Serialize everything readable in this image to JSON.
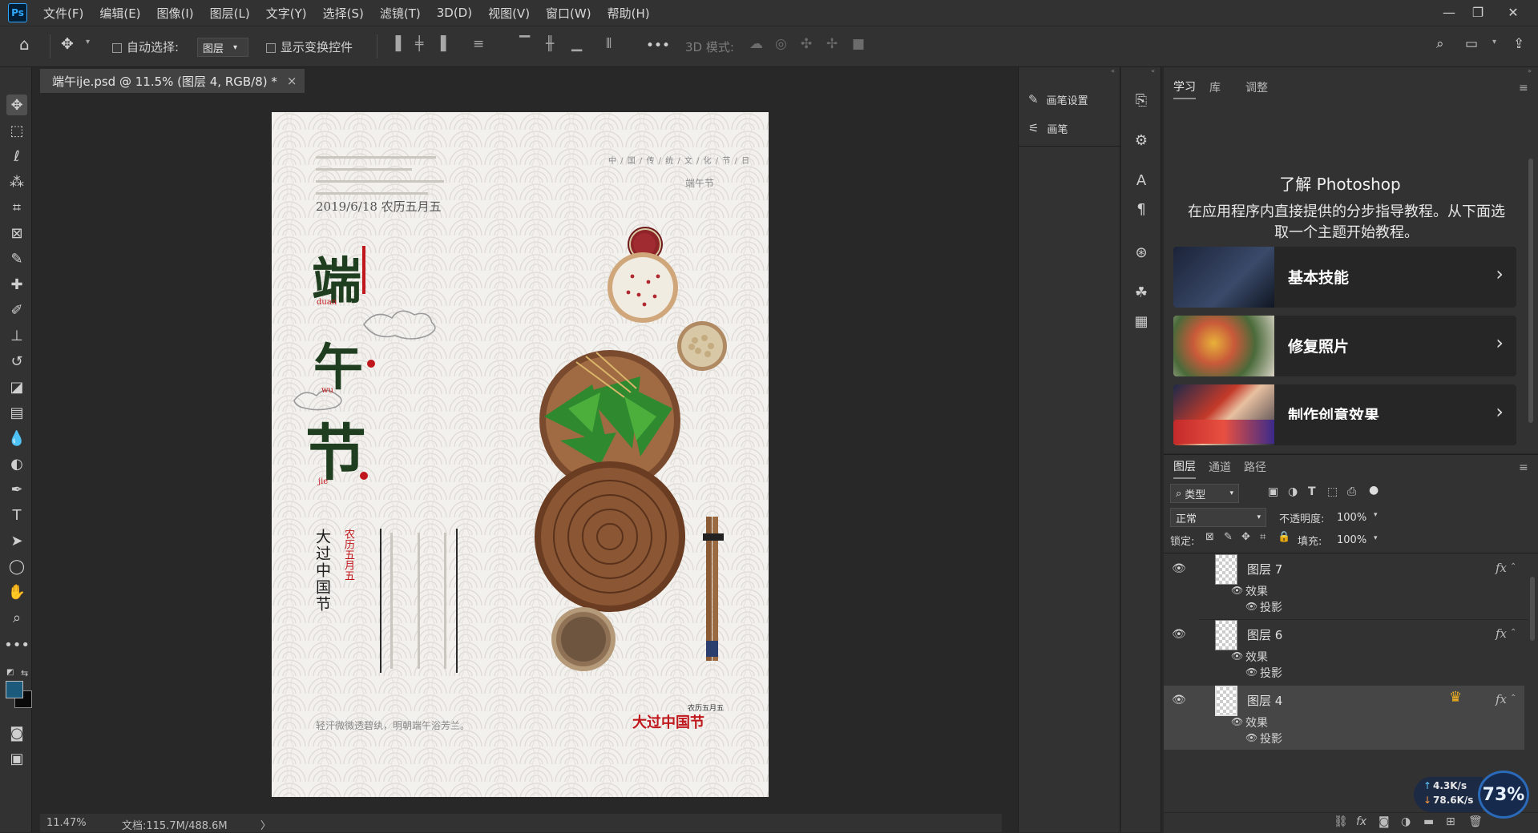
{
  "menubar": {
    "logo": "Ps",
    "items": [
      "文件(F)",
      "编辑(E)",
      "图像(I)",
      "图层(L)",
      "文字(Y)",
      "选择(S)",
      "滤镜(T)",
      "3D(D)",
      "视图(V)",
      "窗口(W)",
      "帮助(H)"
    ],
    "window_controls": [
      "—",
      "❐",
      "✕"
    ]
  },
  "options_bar": {
    "auto_select_label": "自动选择:",
    "auto_select_target": "图层",
    "show_transform_label": "显示变换控件",
    "more": "•••",
    "mode_3d_label": "3D 模式:"
  },
  "document": {
    "tab_title": "端午ije.psd @ 11.5% (图层 4, RGB/8) *",
    "close": "×"
  },
  "status_bar": {
    "zoom": "11.47%",
    "doc_info": "文档:115.7M/488.6M",
    "arrow": "〉"
  },
  "poster": {
    "date": "2019/6/18    农历五月五",
    "top_right_vertical": "中 / 国 / 传 / 统 / 文 / 化 / 节 / 日",
    "top_right_small": "端午节",
    "char1": "端",
    "pinyin1": "duan",
    "char2": "午",
    "pinyin2": "wu",
    "char3": "节",
    "pinyin3": "jie",
    "vertical_black": "大过中国节",
    "vertical_red": "农历五月五",
    "bottom_caption": "轻汗微微透碧纨，明朝端午浴芳兰。",
    "bottom_right_small": "农历五月五",
    "bottom_right_red": "大过中国节"
  },
  "brush_panel": {
    "items": [
      "画笔设置",
      "画笔"
    ]
  },
  "learn_panel": {
    "tabs": [
      "学习",
      "库",
      "调整"
    ],
    "title": "了解 Photoshop",
    "description": "在应用程序内直接提供的分步指导教程。从下面选取一个主题开始教程。",
    "tutorials": [
      "基本技能",
      "修复照片",
      "制作创意效果",
      ""
    ]
  },
  "layers_panel": {
    "tabs": [
      "图层",
      "通道",
      "路径"
    ],
    "filter_label": "类型",
    "blend_mode": "正常",
    "opacity_label": "不透明度:",
    "opacity_value": "100%",
    "lock_label": "锁定:",
    "fill_label": "填充:",
    "fill_value": "100%",
    "layers": [
      {
        "name": "图层 7",
        "effects_label": "效果",
        "effect": "投影",
        "fx": "fx"
      },
      {
        "name": "图层 6",
        "effects_label": "效果",
        "effect": "投影",
        "fx": "fx"
      },
      {
        "name": "图层 4",
        "effects_label": "效果",
        "effect": "投影",
        "fx": "fx"
      }
    ]
  },
  "net_widget": {
    "upload": "4.3K/s",
    "download": "78.6K/s",
    "percent": "73%"
  },
  "colors": {
    "foreground": "#1b5a7a",
    "background": "#0a0a0a",
    "poster_green": "#1f3d1f",
    "poster_red": "#c0171d"
  }
}
